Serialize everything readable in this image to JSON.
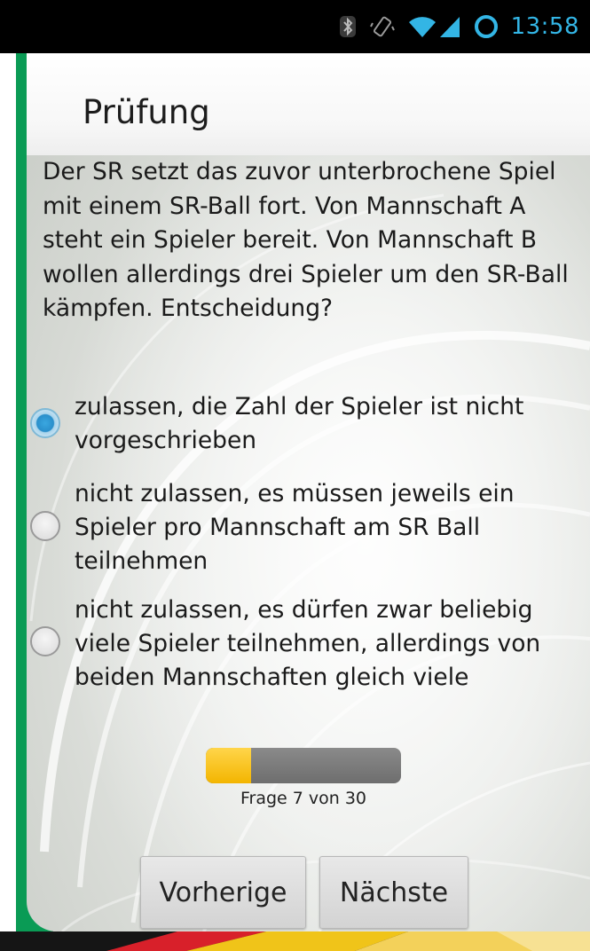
{
  "status_bar": {
    "time": "13:58",
    "icons": [
      "bluetooth-icon",
      "vibrate-icon",
      "wifi-icon",
      "signal-icon",
      "battery-icon"
    ],
    "accent_color": "#33b5e5"
  },
  "header": {
    "title": "Prüfung"
  },
  "quiz": {
    "question": "Der SR setzt das zuvor unterbrochene Spiel mit einem SR-Ball fort. Von Mannschaft A steht ein Spieler bereit. Von Mannschaft B wollen allerdings drei Spieler um den SR-Ball kämpfen. Entscheidung?",
    "options": [
      {
        "label": "zulassen, die Zahl der Spieler ist nicht vorgeschrieben",
        "selected": true
      },
      {
        "label": "nicht zulassen, es müssen jeweils ein Spieler pro Mannschaft am SR Ball teilnehmen",
        "selected": false
      },
      {
        "label": "nicht zulassen, es dürfen zwar beliebig viele Spieler teilnehmen, allerdings von beiden Mannschaften gleich viele",
        "selected": false
      }
    ]
  },
  "progress": {
    "current": 7,
    "total": 30,
    "label": "Frage 7 von 30"
  },
  "navigation": {
    "previous_label": "Vorherige",
    "next_label": "Nächste"
  },
  "colors": {
    "green_accent": "#0a9b55",
    "progress_fill": "#f3b500",
    "radio_selected": "#2a8fcb"
  }
}
